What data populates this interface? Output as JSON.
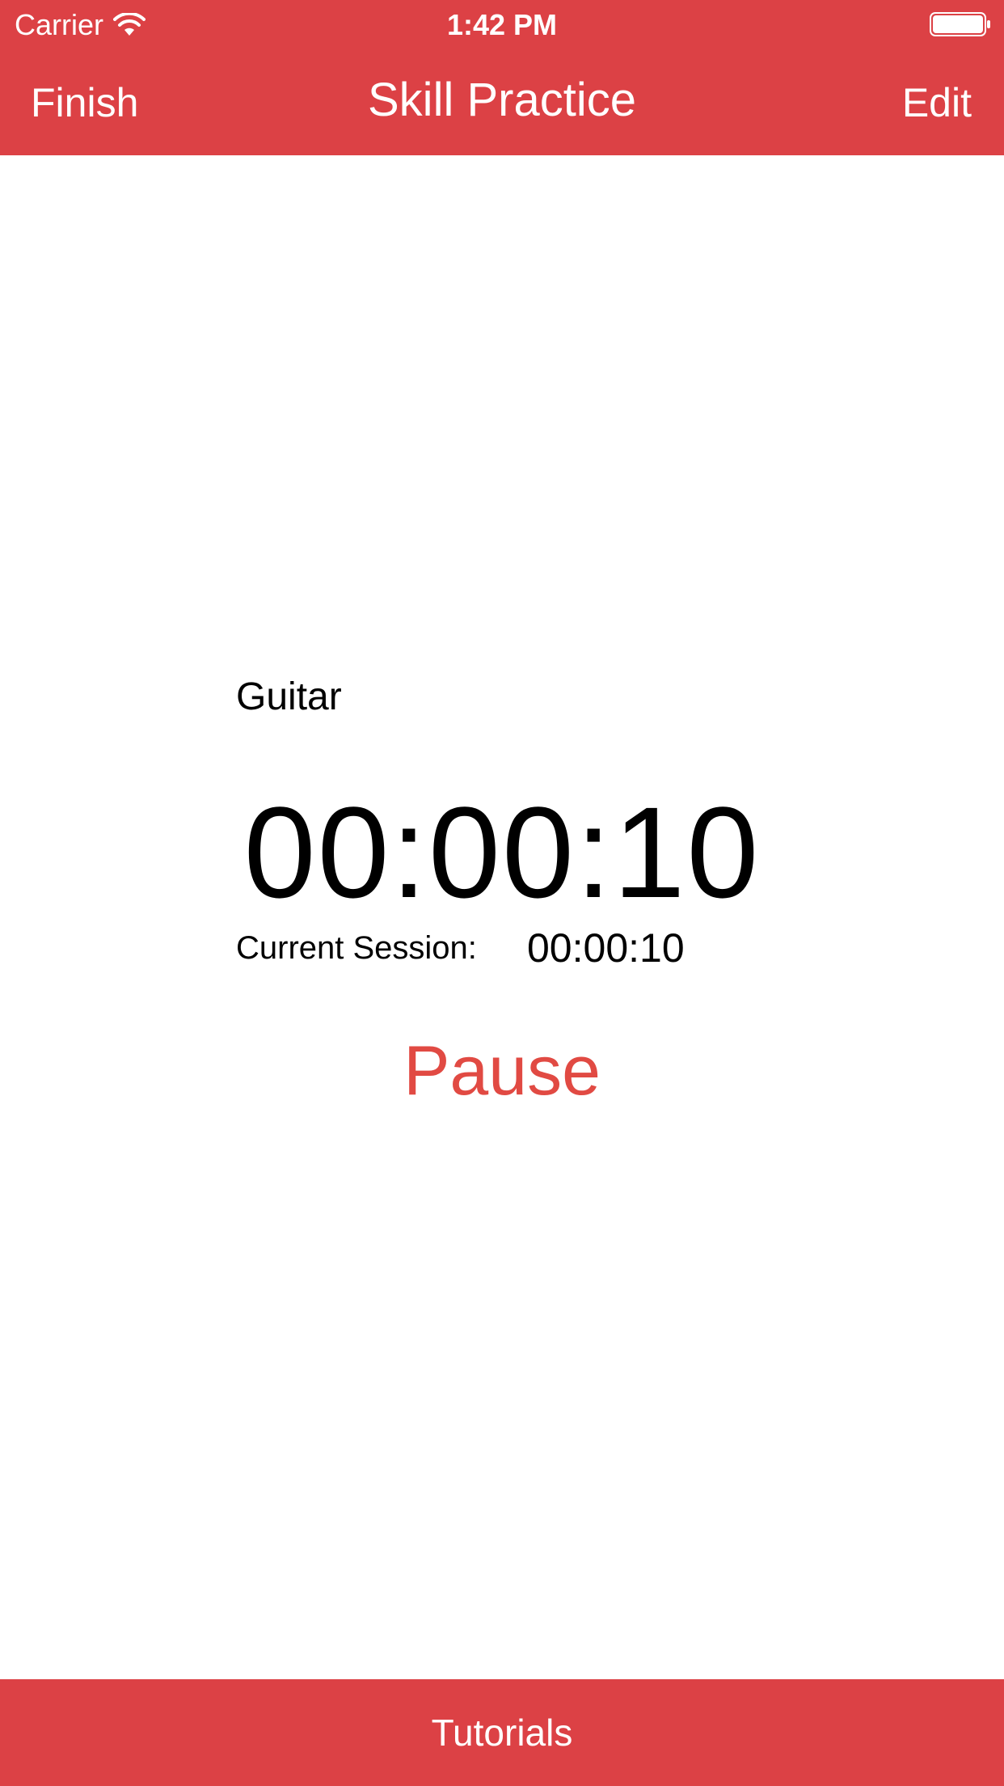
{
  "status_bar": {
    "carrier": "Carrier",
    "time": "1:42 PM",
    "wifi_icon": "wifi-icon",
    "battery_icon": "battery-full-icon"
  },
  "nav": {
    "left_button": "Finish",
    "title": "Skill Practice",
    "right_button": "Edit"
  },
  "main": {
    "skill_name": "Guitar",
    "total_time": "00:00:10",
    "session_label": "Current Session:",
    "session_time": "00:00:10",
    "pause_label": "Pause"
  },
  "bottom_bar": {
    "label": "Tutorials"
  },
  "colors": {
    "accent": "#dc4145",
    "pause_text": "#e14a43"
  }
}
